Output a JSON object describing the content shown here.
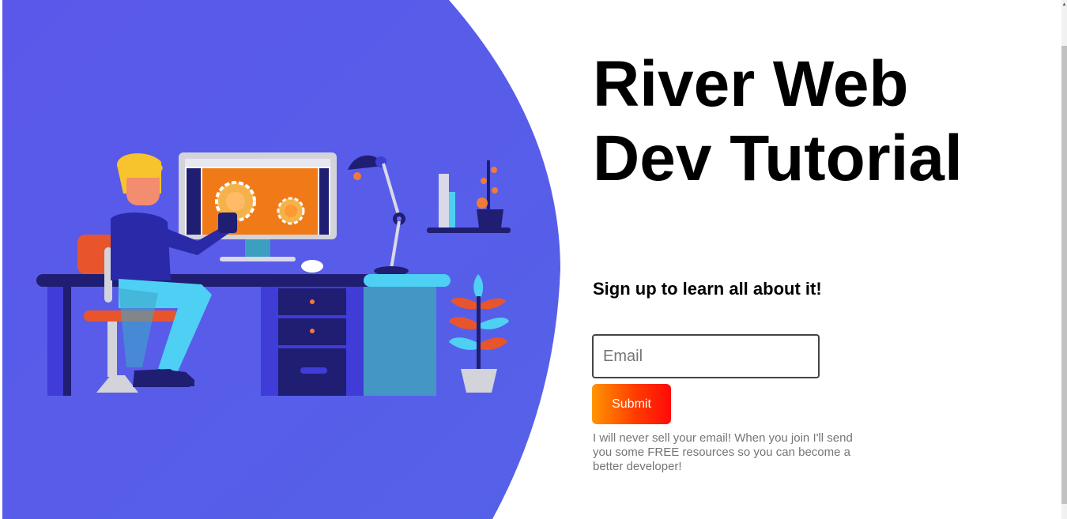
{
  "hero": {
    "title": "River Web Dev Tutorial",
    "subtitle": "Sign up to learn all about it!"
  },
  "signup_form": {
    "email_placeholder": "Email",
    "email_value": "",
    "submit_label": "Submit",
    "note": "I will never sell your email! When you join I'll send you some FREE resources so you can become a better developer!"
  },
  "colors": {
    "hero_blob": "#5657e8",
    "submit_gradient_start": "#ff9500",
    "submit_gradient_end": "#ff0a0a",
    "note_text": "#757575"
  },
  "icons": {
    "illustration": "developer-at-desk-illustration"
  }
}
